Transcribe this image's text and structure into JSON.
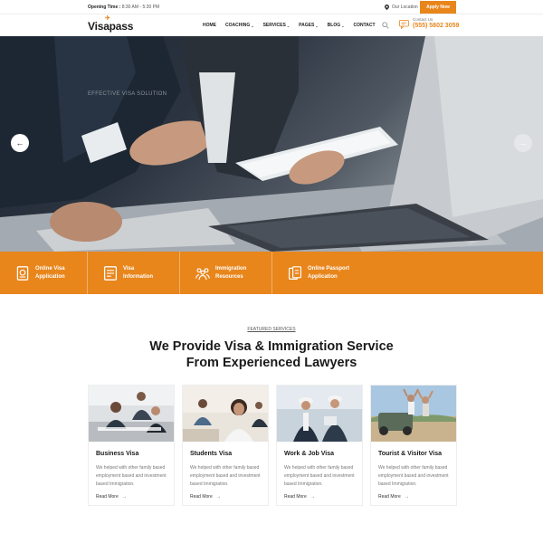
{
  "topbar": {
    "opening_label": "Opening Time :",
    "opening_hours": "8:30 AM - 5:30 PM",
    "location": "Our Location",
    "apply_button": "Apply Now"
  },
  "header": {
    "logo": "Visapass",
    "nav": [
      {
        "label": "HOME",
        "dropdown": false
      },
      {
        "label": "COACHING",
        "dropdown": true
      },
      {
        "label": "SERVICES",
        "dropdown": true
      },
      {
        "label": "PAGES",
        "dropdown": true
      },
      {
        "label": "BLOG",
        "dropdown": true
      },
      {
        "label": "CONTACT",
        "dropdown": false
      }
    ],
    "contact_label": "Contact Us",
    "contact_phone": "(555) 5802 3059"
  },
  "hero": {
    "eyebrow": "EFFECTIVE VISA SOLUTION",
    "prev_icon": "arrow-left-icon",
    "next_icon": "arrow-right-icon"
  },
  "band": [
    {
      "label": "Online Visa\nApplication",
      "icon": "passport-icon"
    },
    {
      "label": "Visa\nInformation",
      "icon": "document-icon"
    },
    {
      "label": "Immigration\nResources",
      "icon": "people-icon"
    },
    {
      "label": "Online Passport\nApplication",
      "icon": "files-icon"
    }
  ],
  "featured": {
    "eyebrow": "FEATURED SERVICES",
    "headline_line1": "We Provide Visa & Immigration Service",
    "headline_line2": "From Experienced Lawyers"
  },
  "cards": [
    {
      "title": "Business Visa",
      "desc": "We helped with other family based employment based and investment based Immigration.",
      "link": "Read More"
    },
    {
      "title": "Students Visa",
      "desc": "We helped with other family based employment based and investment based Immigration.",
      "link": "Read More"
    },
    {
      "title": "Work & Job Visa",
      "desc": "We helped with other family based employment based and investment based Immigration.",
      "link": "Read More"
    },
    {
      "title": "Tourist & Visitor Visa",
      "desc": "We helped with other family based employment based and investment based Immigration.",
      "link": "Read More"
    }
  ],
  "colors": {
    "accent": "#e8861c",
    "dark": "#1a1a1a"
  }
}
